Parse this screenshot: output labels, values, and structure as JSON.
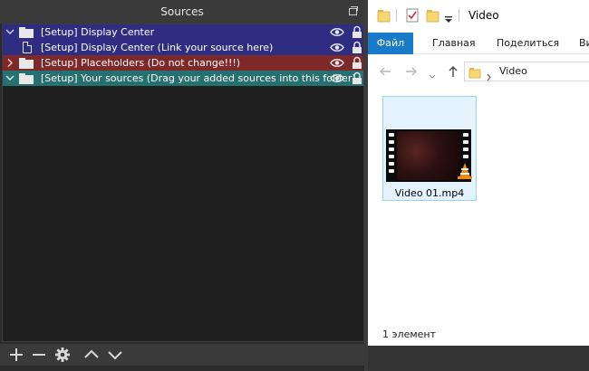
{
  "obs": {
    "panel_title": "Sources",
    "sources": [
      {
        "label": "[Setup] Display Center",
        "kind": "group",
        "expanded": true,
        "bg": "#2e2d82"
      },
      {
        "label": "[Setup] Display Center (Link your source here)",
        "kind": "source",
        "bg": "#2e2d82"
      },
      {
        "label": "[Setup] Placeholders (Do not change!!!)",
        "kind": "group",
        "expanded": false,
        "bg": "#7e2929"
      },
      {
        "label": "[Setup] Your sources (Drag your added sources into this folder)",
        "kind": "group",
        "expanded": true,
        "bg": "#277070"
      }
    ],
    "toolbar": [
      "add-icon",
      "remove-icon",
      "gear-icon",
      "move-up-icon",
      "move-down-icon"
    ]
  },
  "explorer": {
    "title": "Video",
    "tabs": [
      "Файл",
      "Главная",
      "Поделиться",
      "Ви"
    ],
    "address": "Video",
    "files": [
      {
        "name": "Video 01.mp4"
      }
    ],
    "status": "1 элемент"
  }
}
